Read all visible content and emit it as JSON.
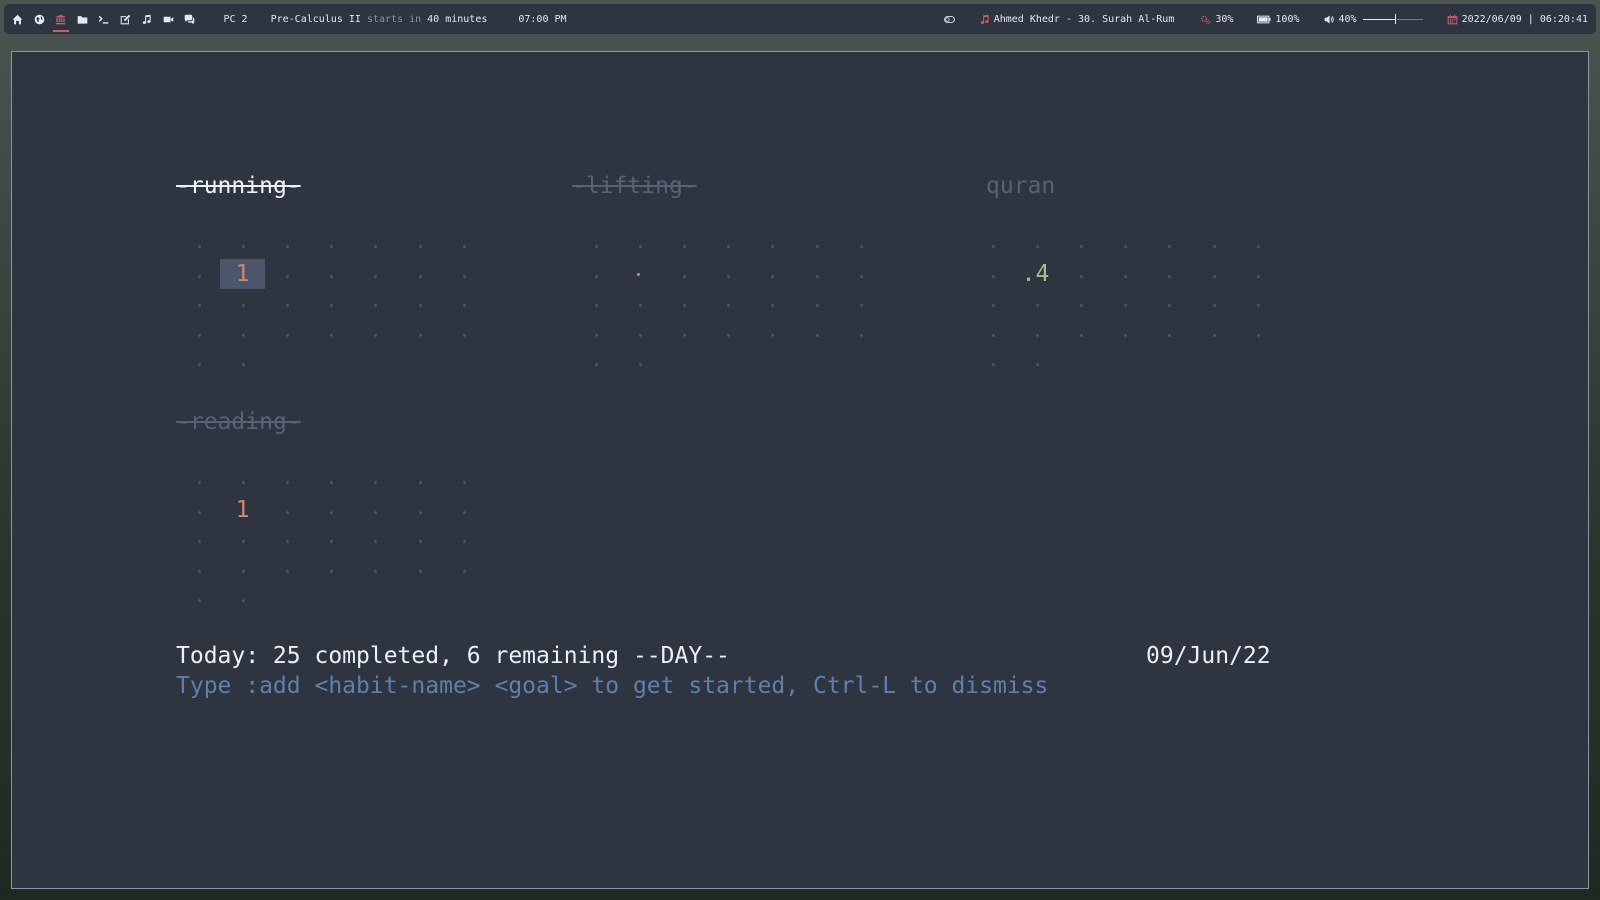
{
  "topbar": {
    "workspaces": [
      {
        "icon": "home-icon",
        "active": false
      },
      {
        "icon": "globe-icon",
        "active": false
      },
      {
        "icon": "university-icon",
        "active": true
      },
      {
        "icon": "folder-icon",
        "active": false
      },
      {
        "icon": "terminal-icon",
        "active": false
      },
      {
        "icon": "edit-icon",
        "active": false
      },
      {
        "icon": "music-icon",
        "active": false
      },
      {
        "icon": "video-icon",
        "active": false
      },
      {
        "icon": "chat-icon",
        "active": false
      }
    ],
    "pc_label": "PC 2",
    "event_name": "Pre-Calculus II",
    "event_starts": "starts in",
    "event_in": "40 minutes",
    "event_time": "07:00 PM",
    "now_playing": "Ahmed Khedr - 30. Surah Al-Rum",
    "cpu": "30%",
    "battery": "100%",
    "volume": "40%",
    "volume_level": 0.4,
    "datetime": "2022/06/09 | 06:20:41"
  },
  "habits": [
    {
      "name": "running",
      "completed": true,
      "active": true,
      "cell_value": "1"
    },
    {
      "name": "lifting",
      "completed": true,
      "active": false,
      "cell_value": "·"
    },
    {
      "name": "quran",
      "completed": false,
      "active": false,
      "cell_value": ".4"
    },
    {
      "name": "reading",
      "completed": true,
      "active": false,
      "cell_value": "1"
    }
  ],
  "status": {
    "summary": "Today: 25 completed, 6 remaining --DAY--",
    "date": "09/Jun/22"
  },
  "hint": "Type :add <habit-name> <goal> to get started, Ctrl-L to dismiss",
  "colors": {
    "background": "#2e3440",
    "accent_red": "#bf616a",
    "orange": "#d08770",
    "green": "#a3be8c",
    "blue": "#5e81ac"
  }
}
